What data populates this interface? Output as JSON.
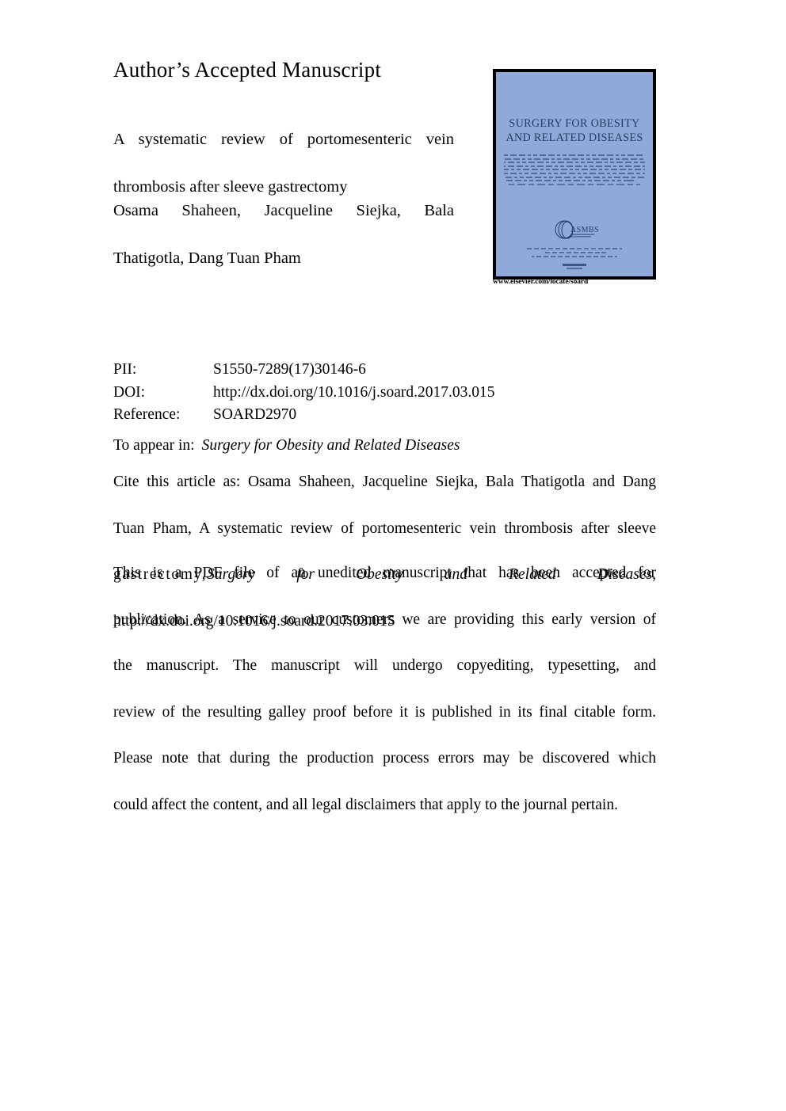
{
  "header": {
    "accepted_manuscript_label": "Author’s Accepted Manuscript"
  },
  "article": {
    "title_line1": "A systematic review of portomesenteric vein",
    "title_line2": "thrombosis after sleeve gastrectomy",
    "authors_line1": "Osama Shaheen, Jacqueline Siejka, Bala",
    "authors_line2": "Thatigotla, Dang Tuan Pham"
  },
  "cover": {
    "journal_title_line1": "SURGERY FOR OBESITY",
    "journal_title_line2": "AND RELATED DISEASES",
    "society_logo_label": "ASMBS",
    "url": "www.elsevier.com/locate/soard",
    "background_color": "#8fa9d8",
    "title_color": "#273a66",
    "border_color": "#000000"
  },
  "metadata": {
    "rows": [
      {
        "label": "PII:",
        "value": "S1550-7289(17)30146-6"
      },
      {
        "label": "DOI:",
        "value": "http://dx.doi.org/10.1016/j.soard.2017.03.015"
      },
      {
        "label": "Reference:",
        "value": "SOARD2970"
      }
    ]
  },
  "appear": {
    "prefix": "To appear in:",
    "journal": "Surgery for Obesity and Related Diseases"
  },
  "citation": {
    "line1": "Cite this article as: Osama Shaheen, Jacqueline Siejka, Bala Thatigotla and Dang",
    "line2": "Tuan Pham, A systematic review of portomesenteric vein thrombosis after sleeve",
    "line3_prefix": "gastrectomy,",
    "line3_journal": "Surgery for Obesity and Related Diseases,",
    "line4_doi": "http://dx.doi.org/10.1016/j.soard.2017.03.015"
  },
  "disclaimer": {
    "line1": "This is a PDF file of an unedited manuscript that has been accepted for",
    "line2": "publication. As a service to our customers we are providing this early version of",
    "line3": "the manuscript. The manuscript will undergo copyediting, typesetting, and",
    "line4": "review of the resulting galley proof before it is published in its final citable form.",
    "line5": "Please note that during the production process errors may be discovered which",
    "line6": "could affect the content, and all legal disclaimers that apply to the journal pertain."
  }
}
